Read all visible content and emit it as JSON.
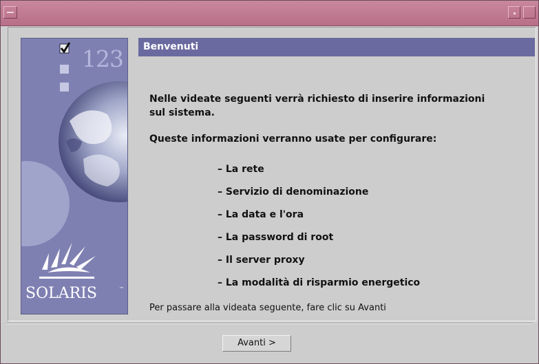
{
  "window": {
    "title": ""
  },
  "sidebar": {
    "number_graphic": "123",
    "logo_text": "SOLARIS",
    "trademark": "™"
  },
  "panel": {
    "title": "Benvenuti",
    "intro": "Nelle videate seguenti verrà richiesto di inserire informazioni sul sistema.",
    "used_for": "Queste informazioni verranno usate per configurare:",
    "items": [
      "– La rete",
      "– Servizio di denominazione",
      "– La data e l'ora",
      "– La password di root",
      "– Il server proxy",
      "– La modalità di risparmio energetico"
    ],
    "hint": "Per passare alla videata seguente, fare clic su Avanti"
  },
  "footer": {
    "next_label": "Avanti >"
  },
  "colors": {
    "titlebar": "#b86e88",
    "panel_header": "#6a6aa0",
    "sidebar": "#7f80b2",
    "background": "#cdcdcd"
  }
}
